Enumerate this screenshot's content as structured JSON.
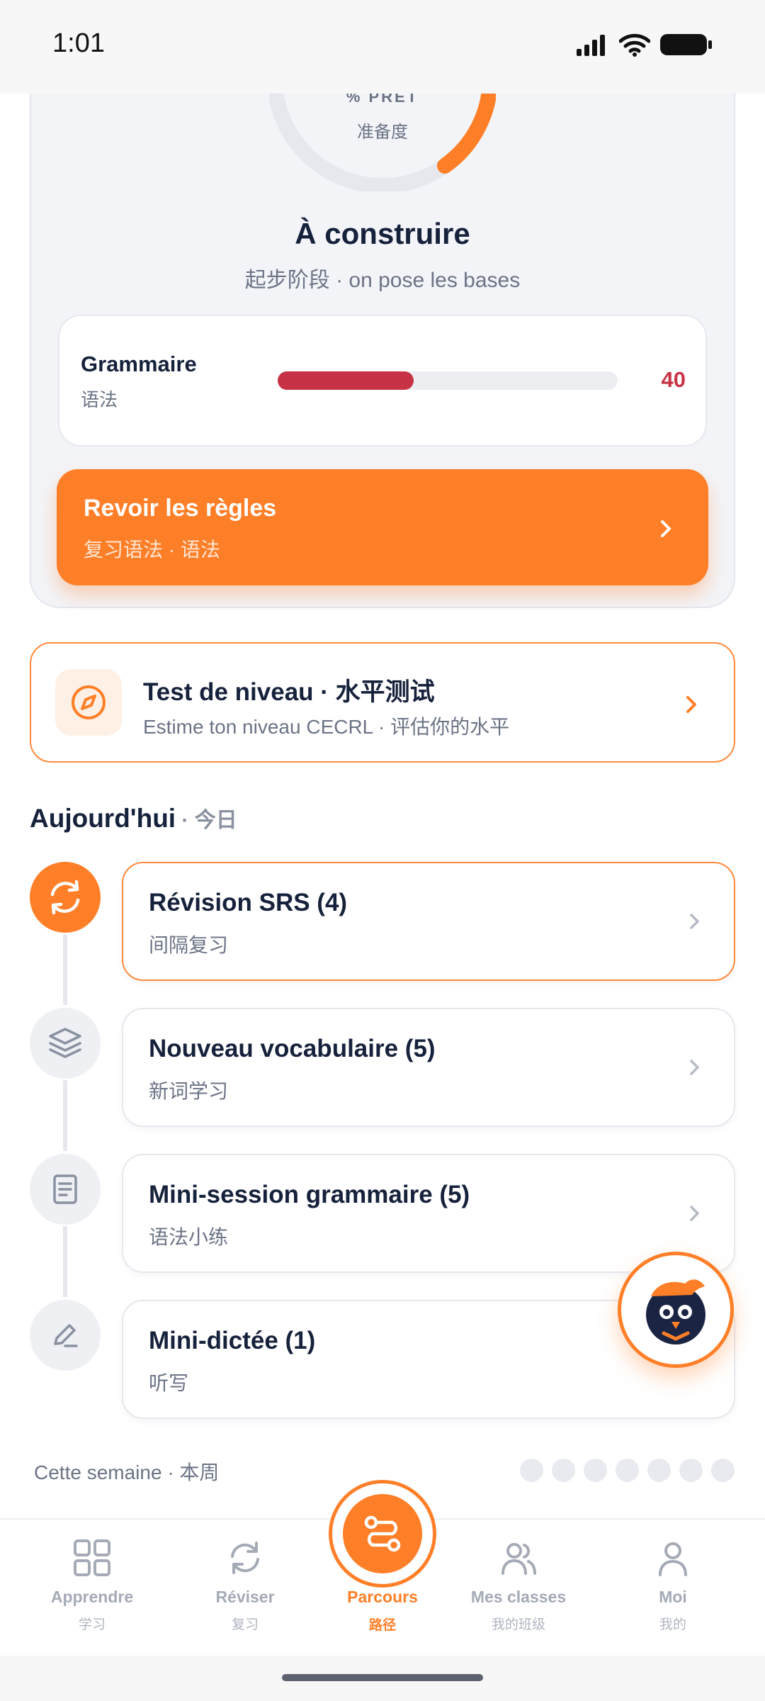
{
  "status_bar": {
    "time": "1:01"
  },
  "readiness": {
    "percent_label": "% PRET",
    "percent_sublabel": "准备度",
    "level_title": "À construire",
    "level_subtitle": "起步阶段 · on pose les bases",
    "skill": {
      "name": "Grammaire",
      "sub": "语法",
      "value": "40",
      "fraction": 0.4,
      "color": "#c83246"
    },
    "review_button": {
      "title": "Revoir les règles",
      "sub": "复习语法 · 语法"
    }
  },
  "test_card": {
    "title": "Test de niveau · 水平测试",
    "sub": "Estime ton niveau CECRL · 评估你的水平",
    "icon": "compass-icon"
  },
  "today": {
    "heading": "Aujourd'hui",
    "heading_zh": " · 今日",
    "steps": [
      {
        "title": "Révision SRS (4)",
        "sub": "间隔复习",
        "icon": "refresh-icon",
        "active": true
      },
      {
        "title": "Nouveau vocabulaire (5)",
        "sub": "新词学习",
        "icon": "layers-icon",
        "active": false
      },
      {
        "title": "Mini-session grammaire (5)",
        "sub": "语法小练",
        "icon": "book-icon",
        "active": false
      },
      {
        "title": "Mini-dictée (1)",
        "sub": "听写",
        "icon": "pencil-icon",
        "active": false
      }
    ]
  },
  "week": {
    "label": "Cette semaine · 本周",
    "days_done": 0,
    "days_total": 7
  },
  "nav": {
    "items": [
      {
        "label": "Apprendre",
        "sub": "学习",
        "icon": "grid-icon"
      },
      {
        "label": "Réviser",
        "sub": "复习",
        "icon": "refresh-icon"
      },
      {
        "label": "Parcours",
        "sub": "路径",
        "icon": "route-icon",
        "active": true
      },
      {
        "label": "Mes classes",
        "sub": "我的班级",
        "icon": "users-icon"
      },
      {
        "label": "Moi",
        "sub": "我的",
        "icon": "user-icon"
      }
    ]
  },
  "colors": {
    "accent": "#ff7f28",
    "danger": "#c83246",
    "text": "#16213b",
    "muted": "#6b7385"
  }
}
